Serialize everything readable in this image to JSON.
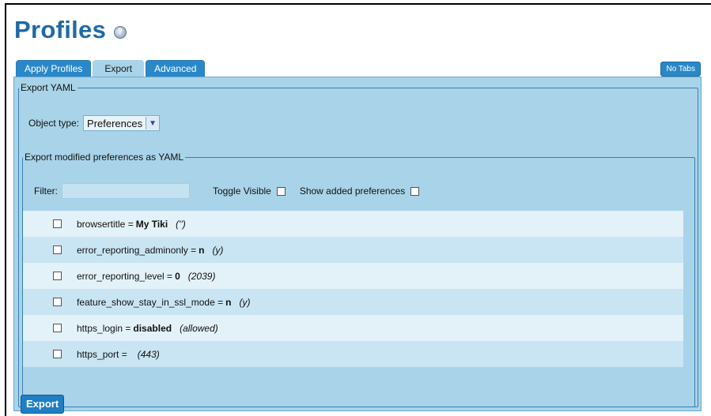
{
  "page": {
    "title": "Profiles"
  },
  "tabs": [
    {
      "label": "Apply Profiles"
    },
    {
      "label": "Export"
    },
    {
      "label": "Advanced"
    }
  ],
  "no_tabs_label": "No Tabs",
  "export_yaml": {
    "legend": "Export YAML",
    "object_type_label": "Object type:",
    "object_type_value": "Preferences",
    "modified": {
      "legend": "Export modified preferences as YAML",
      "filter_label": "Filter:",
      "filter_value": "",
      "toggle_visible_label": "Toggle Visible",
      "show_added_label": "Show added preferences",
      "items": [
        {
          "name": "browsertitle =",
          "value": "My Tiki",
          "default": "('')"
        },
        {
          "name": "error_reporting_adminonly =",
          "value": "n",
          "default": "(y)"
        },
        {
          "name": "error_reporting_level =",
          "value": "0",
          "default": "(2039)"
        },
        {
          "name": "feature_show_stay_in_ssl_mode =",
          "value": "n",
          "default": "(y)"
        },
        {
          "name": "https_login =",
          "value": "disabled",
          "default": "(allowed)"
        },
        {
          "name": "https_port =",
          "value": "",
          "default": "(443)"
        }
      ]
    },
    "export_button": "Export"
  }
}
